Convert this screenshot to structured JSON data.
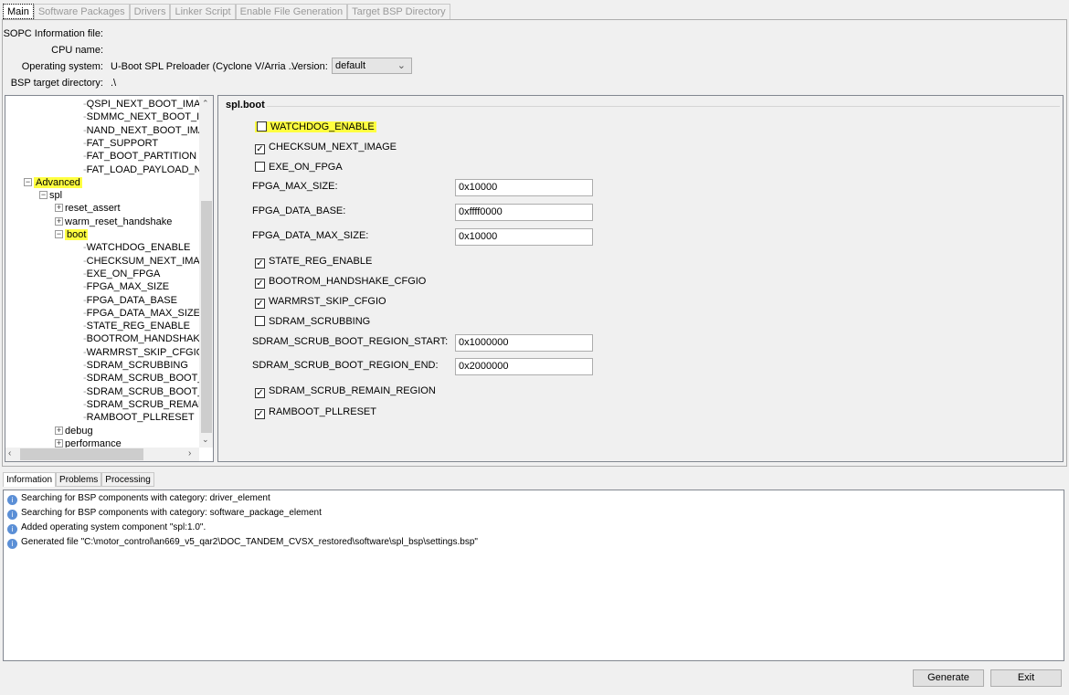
{
  "tabs": [
    "Main",
    "Software Packages",
    "Drivers",
    "Linker Script",
    "Enable File Generation",
    "Target BSP Directory"
  ],
  "info": {
    "sopc_label": "SOPC Information file:",
    "sopc_value": "",
    "cpu_label": "CPU name:",
    "cpu_value": "",
    "os_label": "Operating system:",
    "os_value": "U-Boot SPL Preloader (Cyclone V/Arria ...",
    "version_label": "Version:",
    "version_value": "default",
    "bsp_label": "BSP target directory:",
    "bsp_value": ".\\"
  },
  "tree": [
    {
      "label": "QSPI_NEXT_BOOT_IMAGE",
      "level": 4
    },
    {
      "label": "SDMMC_NEXT_BOOT_IMA",
      "level": 4
    },
    {
      "label": "NAND_NEXT_BOOT_IMAG",
      "level": 4
    },
    {
      "label": "FAT_SUPPORT",
      "level": 4
    },
    {
      "label": "FAT_BOOT_PARTITION",
      "level": 4
    },
    {
      "label": "FAT_LOAD_PAYLOAD_NA",
      "level": 4
    },
    {
      "label": "Advanced",
      "level": 1,
      "expander": "minus",
      "highlight": true
    },
    {
      "label": "spl",
      "level": 2,
      "expander": "minus"
    },
    {
      "label": "reset_assert",
      "level": 3,
      "expander": "plus"
    },
    {
      "label": "warm_reset_handshake",
      "level": 3,
      "expander": "plus"
    },
    {
      "label": "boot",
      "level": 3,
      "expander": "minus",
      "highlight": true
    },
    {
      "label": "WATCHDOG_ENABLE",
      "level": 4
    },
    {
      "label": "CHECKSUM_NEXT_IMAGE",
      "level": 4
    },
    {
      "label": "EXE_ON_FPGA",
      "level": 4
    },
    {
      "label": "FPGA_MAX_SIZE",
      "level": 4
    },
    {
      "label": "FPGA_DATA_BASE",
      "level": 4
    },
    {
      "label": "FPGA_DATA_MAX_SIZE",
      "level": 4
    },
    {
      "label": "STATE_REG_ENABLE",
      "level": 4
    },
    {
      "label": "BOOTROM_HANDSHAKE_",
      "level": 4
    },
    {
      "label": "WARMRST_SKIP_CFGIO",
      "level": 4
    },
    {
      "label": "SDRAM_SCRUBBING",
      "level": 4
    },
    {
      "label": "SDRAM_SCRUB_BOOT_RE",
      "level": 4
    },
    {
      "label": "SDRAM_SCRUB_BOOT_RE",
      "level": 4
    },
    {
      "label": "SDRAM_SCRUB_REMAIN_I",
      "level": 4
    },
    {
      "label": "RAMBOOT_PLLRESET",
      "level": 4
    },
    {
      "label": "debug",
      "level": 3,
      "expander": "plus"
    },
    {
      "label": "performance",
      "level": 3,
      "expander": "plus"
    }
  ],
  "panel": {
    "title": "spl.boot",
    "items": [
      {
        "type": "checkbox",
        "label": "WATCHDOG_ENABLE",
        "checked": false,
        "highlight": true
      },
      {
        "type": "checkbox",
        "label": "CHECKSUM_NEXT_IMAGE",
        "checked": true
      },
      {
        "type": "checkbox",
        "label": "EXE_ON_FPGA",
        "checked": false
      },
      {
        "type": "field",
        "label": "FPGA_MAX_SIZE:",
        "value": "0x10000"
      },
      {
        "type": "field",
        "label": "FPGA_DATA_BASE:",
        "value": "0xffff0000"
      },
      {
        "type": "field",
        "label": "FPGA_DATA_MAX_SIZE:",
        "value": "0x10000"
      },
      {
        "type": "checkbox",
        "label": "STATE_REG_ENABLE",
        "checked": true
      },
      {
        "type": "checkbox",
        "label": "BOOTROM_HANDSHAKE_CFGIO",
        "checked": true
      },
      {
        "type": "checkbox",
        "label": "WARMRST_SKIP_CFGIO",
        "checked": true
      },
      {
        "type": "checkbox",
        "label": "SDRAM_SCRUBBING",
        "checked": false
      },
      {
        "type": "field",
        "label": "SDRAM_SCRUB_BOOT_REGION_START:",
        "value": "0x1000000"
      },
      {
        "type": "field",
        "label": "SDRAM_SCRUB_BOOT_REGION_END:",
        "value": "0x2000000"
      },
      {
        "type": "checkbox",
        "label": "SDRAM_SCRUB_REMAIN_REGION",
        "checked": true
      },
      {
        "type": "checkbox",
        "label": "RAMBOOT_PLLRESET",
        "checked": true
      }
    ]
  },
  "bottom_tabs": [
    "Information",
    "Problems",
    "Processing"
  ],
  "log": [
    "Searching for BSP components with category: driver_element",
    "Searching for BSP components with category: software_package_element",
    "Added operating system component \"spl:1.0\".",
    "Generated file \"C:\\motor_control\\an669_v5_qar2\\DOC_TANDEM_CVSX_restored\\software\\spl_bsp\\settings.bsp\""
  ],
  "buttons": {
    "generate": "Generate",
    "exit": "Exit"
  },
  "colors": {
    "highlight": "#ffff40",
    "info_icon": "#5b8fd6"
  }
}
